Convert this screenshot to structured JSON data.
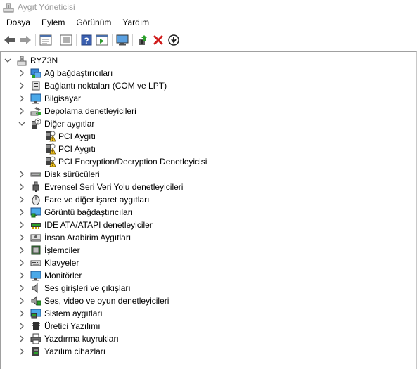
{
  "window": {
    "title": "Aygıt Yöneticisi"
  },
  "menu": [
    "Dosya",
    "Eylem",
    "Görünüm",
    "Yardım"
  ],
  "toolbar": {
    "buttons": [
      "back-icon",
      "forward-icon",
      "properties-icon",
      "view-list-icon",
      "help-icon",
      "run-icon",
      "monitor-scan-icon",
      "update-driver-icon",
      "uninstall-icon",
      "download-icon"
    ]
  },
  "tree": {
    "root": "RYZ3N",
    "categories": [
      {
        "label": "Ağ bağdaştırıcıları",
        "icon": "network-adapter-icon",
        "expanded": false
      },
      {
        "label": "Bağlantı noktaları (COM ve LPT)",
        "icon": "port-icon",
        "expanded": false
      },
      {
        "label": "Bilgisayar",
        "icon": "computer-icon",
        "expanded": false
      },
      {
        "label": "Depolama denetleyicileri",
        "icon": "storage-controller-icon",
        "expanded": false
      },
      {
        "label": "Diğer aygıtlar",
        "icon": "other-devices-icon",
        "expanded": true,
        "children": [
          "PCI Aygıtı",
          "PCI Aygıtı",
          "PCI Encryption/Decryption Denetleyicisi"
        ]
      },
      {
        "label": "Disk sürücüleri",
        "icon": "disk-drive-icon",
        "expanded": false
      },
      {
        "label": "Evrensel Seri Veri Yolu denetleyicileri",
        "icon": "usb-icon",
        "expanded": false
      },
      {
        "label": "Fare ve diğer işaret aygıtları",
        "icon": "mouse-icon",
        "expanded": false
      },
      {
        "label": "Görüntü bağdaştırıcıları",
        "icon": "display-adapter-icon",
        "expanded": false
      },
      {
        "label": "IDE ATA/ATAPI denetleyiciler",
        "icon": "ide-controller-icon",
        "expanded": false
      },
      {
        "label": "İnsan Arabirim Aygıtları",
        "icon": "hid-icon",
        "expanded": false
      },
      {
        "label": "İşlemciler",
        "icon": "processor-icon",
        "expanded": false
      },
      {
        "label": "Klavyeler",
        "icon": "keyboard-icon",
        "expanded": false
      },
      {
        "label": "Monitörler",
        "icon": "monitor-icon",
        "expanded": false
      },
      {
        "label": "Ses girişleri ve çıkışları",
        "icon": "speaker-icon",
        "expanded": false
      },
      {
        "label": "Ses, video ve oyun denetleyicileri",
        "icon": "sound-controller-icon",
        "expanded": false
      },
      {
        "label": "Sistem aygıtları",
        "icon": "system-device-icon",
        "expanded": false
      },
      {
        "label": "Üretici Yazılımı",
        "icon": "firmware-icon",
        "expanded": false
      },
      {
        "label": "Yazdırma kuyrukları",
        "icon": "printer-icon",
        "expanded": false
      },
      {
        "label": "Yazılım cihazları",
        "icon": "software-device-icon",
        "expanded": false
      }
    ]
  },
  "colors": {
    "title_text": "#999999",
    "chevron": "#606060",
    "warning": "#f5c518",
    "accent_blue": "#1e7fd6"
  }
}
